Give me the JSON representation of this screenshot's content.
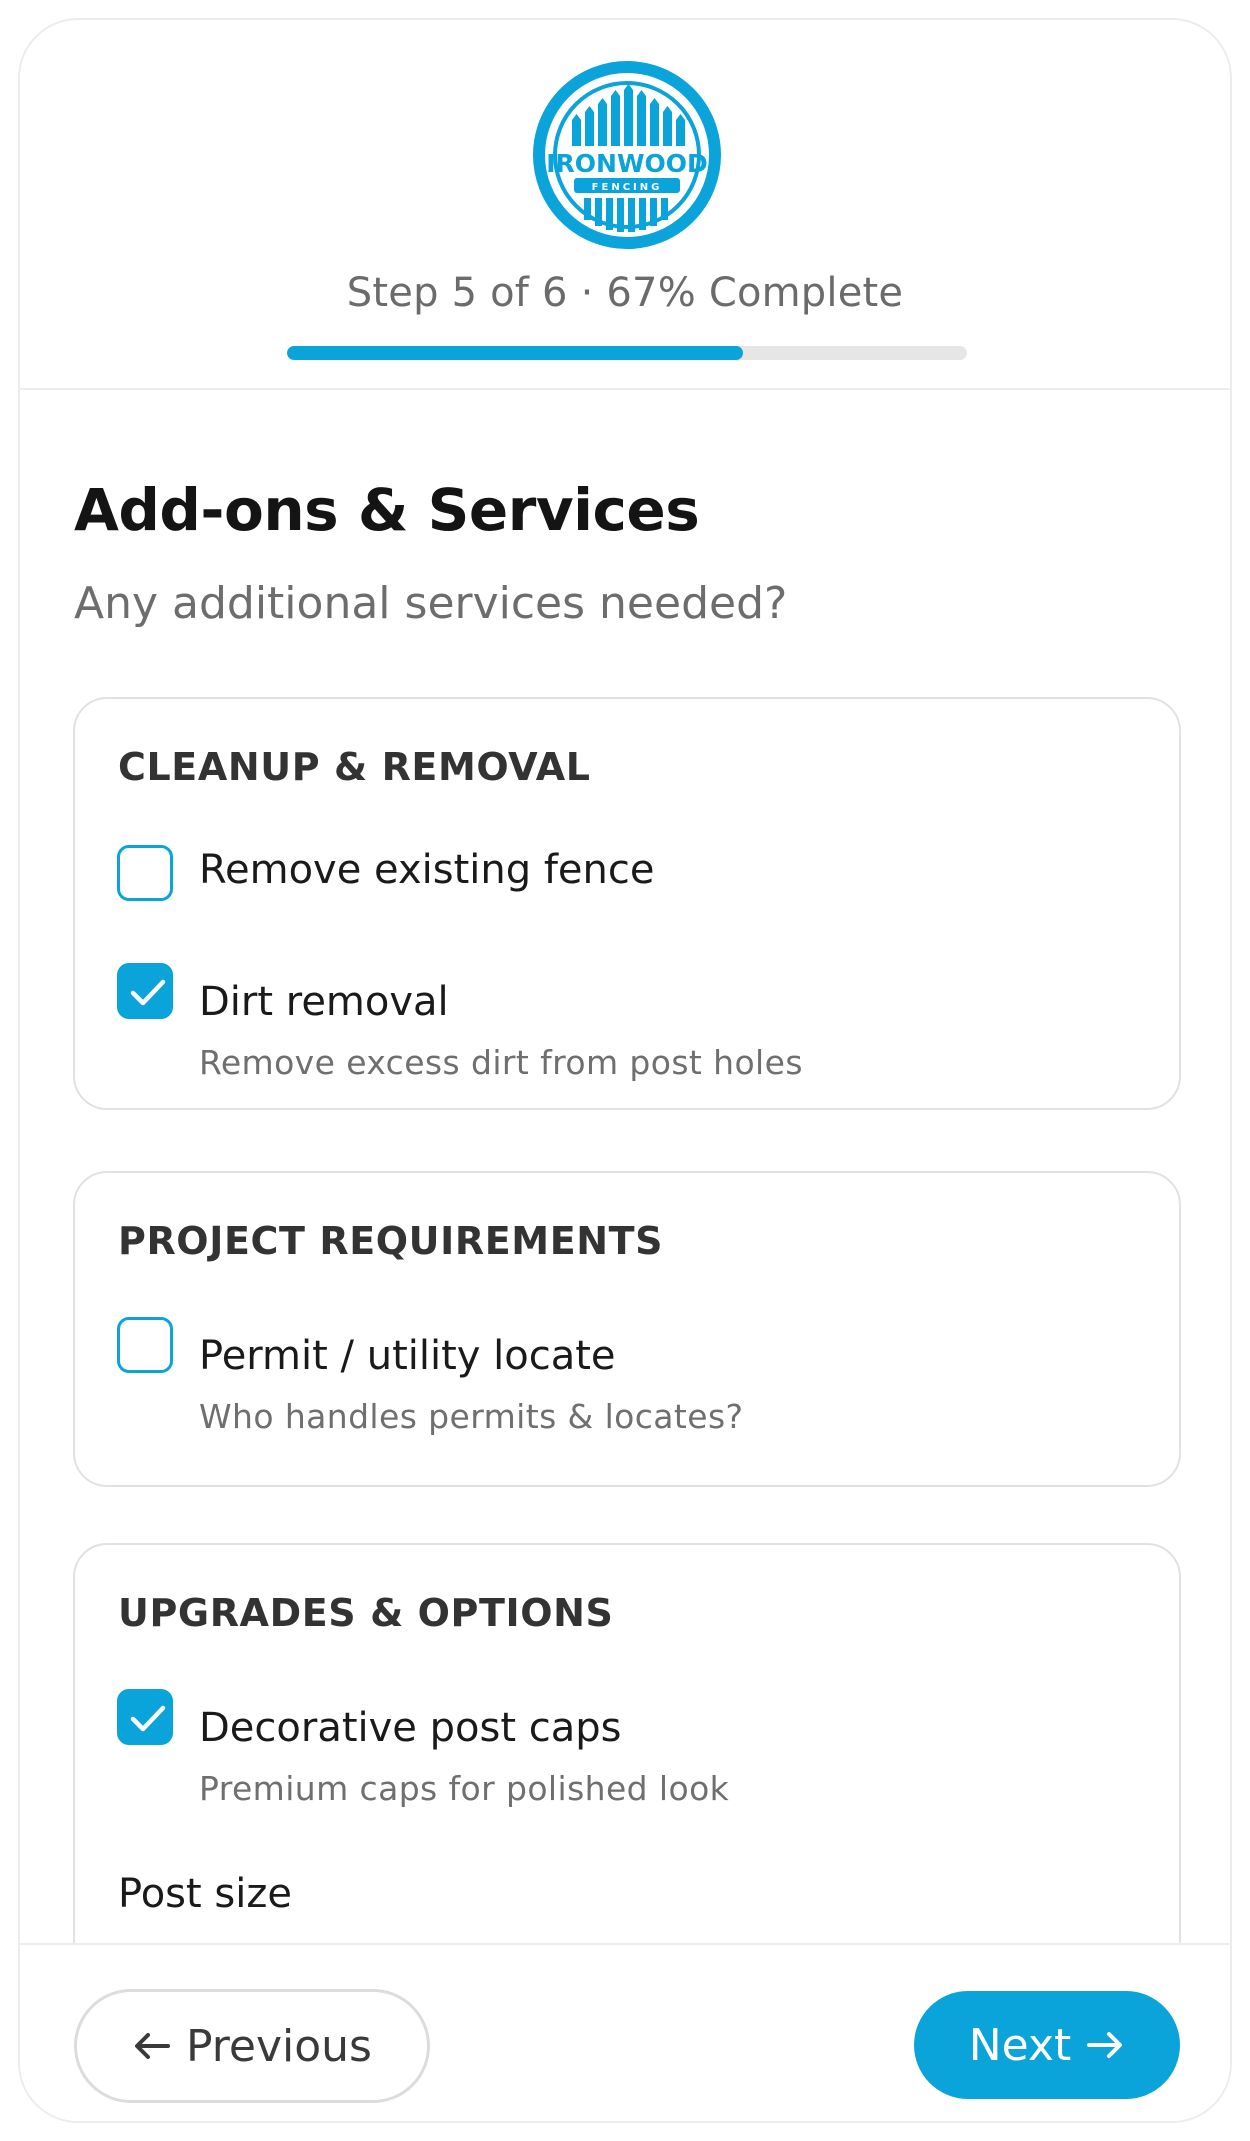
{
  "brand": {
    "name": "IRONWOOD",
    "tagline": "FENCING",
    "accent_color": "#0aa3da"
  },
  "progress": {
    "step_text": "Step 5 of 6 · 67% Complete",
    "fraction": 0.67
  },
  "page": {
    "title": "Add-ons & Services",
    "subtitle": "Any additional services needed?"
  },
  "sections": [
    {
      "title": "CLEANUP & REMOVAL",
      "options": [
        {
          "label": "Remove existing fence",
          "description": "",
          "checked": false
        },
        {
          "label": "Dirt removal",
          "description": "Remove excess dirt from post holes",
          "checked": true
        }
      ]
    },
    {
      "title": "PROJECT REQUIREMENTS",
      "options": [
        {
          "label": "Permit / utility locate",
          "description": "Who handles permits & locates?",
          "checked": false
        }
      ]
    },
    {
      "title": "UPGRADES & OPTIONS",
      "options": [
        {
          "label": "Decorative post caps",
          "description": "Premium caps for polished look",
          "checked": true
        }
      ],
      "field_label": "Post size"
    }
  ],
  "footer": {
    "previous_label": "Previous",
    "next_label": "Next",
    "previous_icon": "arrow-left-icon",
    "next_icon": "arrow-right-icon"
  }
}
